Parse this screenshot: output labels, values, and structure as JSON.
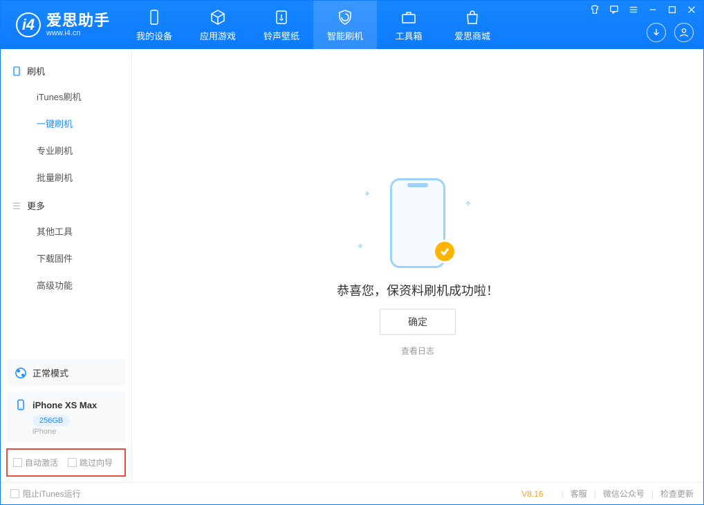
{
  "app": {
    "name": "爱思助手",
    "url": "www.i4.cn"
  },
  "tabs": {
    "device": "我的设备",
    "apps": "应用游戏",
    "ringtone": "铃声壁纸",
    "flash": "智能刷机",
    "toolbox": "工具箱",
    "store": "爱思商城"
  },
  "sidebar": {
    "section_flash": "刷机",
    "items_flash": {
      "itunes": "iTunes刷机",
      "oneclick": "一键刷机",
      "pro": "专业刷机",
      "batch": "批量刷机"
    },
    "section_more": "更多",
    "items_more": {
      "other": "其他工具",
      "firmware": "下载固件",
      "advanced": "高级功能"
    }
  },
  "mode": {
    "label": "正常模式"
  },
  "device": {
    "name": "iPhone XS Max",
    "storage": "256GB",
    "type": "iPhone"
  },
  "checks": {
    "auto_activate": "自动激活",
    "skip_guide": "跳过向导"
  },
  "result": {
    "message": "恭喜您，保资料刷机成功啦！",
    "ok": "确定",
    "log": "查看日志"
  },
  "footer": {
    "block_itunes": "阻止iTunes运行",
    "version": "V8.16",
    "support": "客服",
    "wechat": "微信公众号",
    "update": "检查更新"
  }
}
